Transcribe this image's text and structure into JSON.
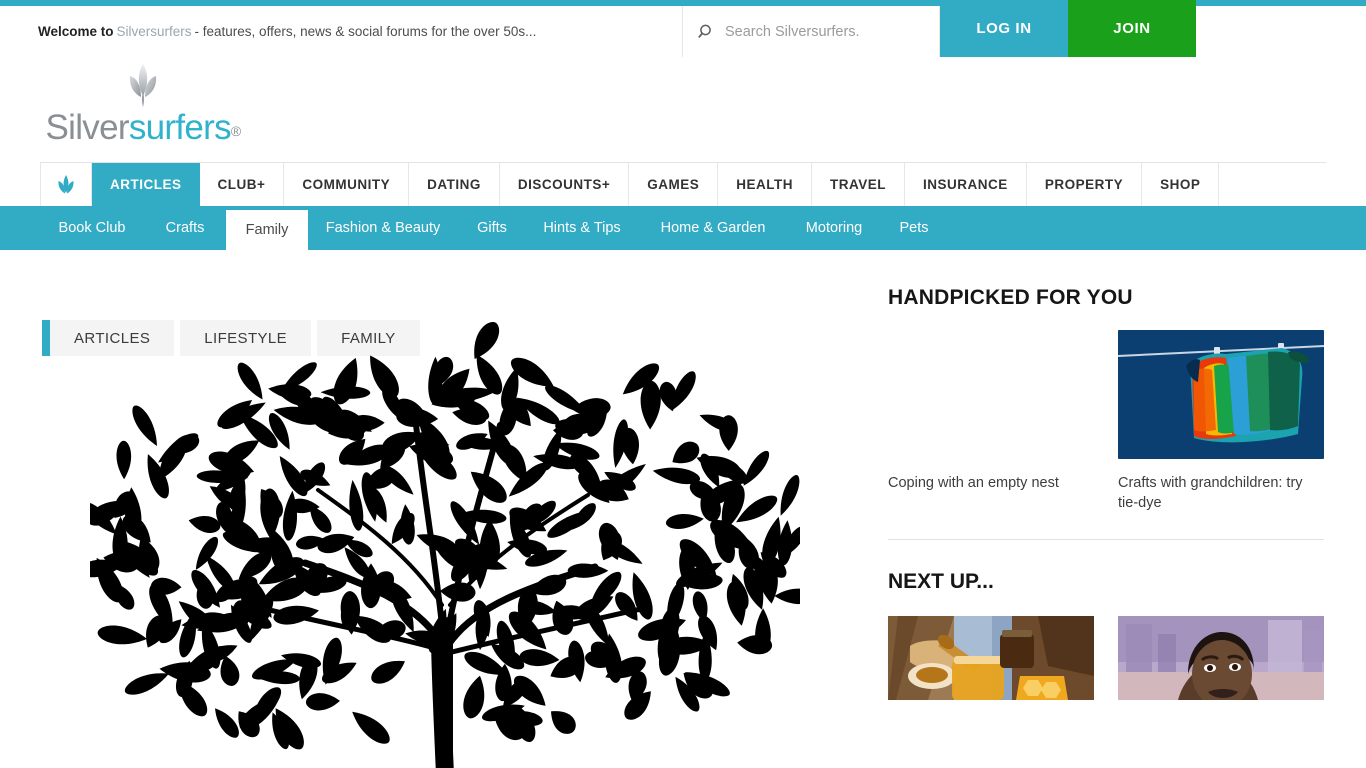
{
  "topbar": {
    "welcome_bold": "Welcome to",
    "welcome_brand": "Silversurfers",
    "welcome_rest": "- features, offers, news & social forums for the over 50s...",
    "search_placeholder": "Search Silversurfers.",
    "search_value": "",
    "search_icon": "search-icon",
    "login_label": "LOG IN",
    "join_label": "JOIN",
    "accent_color": "#32abc4",
    "join_color": "#1aa01a"
  },
  "logo": {
    "part1": "Silver",
    "part2": "surfers",
    "registered": "®",
    "mark_icon": "silversurfers-feather-icon"
  },
  "mainnav": {
    "home_icon": "home-feather-icon",
    "items": [
      {
        "label": "ARTICLES",
        "underline": "#32abc4",
        "active": true
      },
      {
        "label": "CLUB+",
        "underline": "#123a5c",
        "active": false
      },
      {
        "label": "COMMUNITY",
        "underline": "#1566b5",
        "active": false
      },
      {
        "label": "DATING",
        "underline": "#cf2030",
        "active": false
      },
      {
        "label": "DISCOUNTS+",
        "underline": "#e8853a",
        "active": false
      },
      {
        "label": "GAMES",
        "underline": "#34b7cc",
        "active": false
      },
      {
        "label": "HEALTH",
        "underline": "#ec3b16",
        "active": false
      },
      {
        "label": "TRAVEL",
        "underline": "#f5c220",
        "active": false
      },
      {
        "label": "INSURANCE",
        "underline": "#8c8c8c",
        "active": false
      },
      {
        "label": "PROPERTY",
        "underline": "#8e1212",
        "active": false
      },
      {
        "label": "SHOP",
        "underline": "#a618d6",
        "active": false
      }
    ]
  },
  "subnav": {
    "items": [
      {
        "label": "Book Club",
        "active": false
      },
      {
        "label": "Crafts",
        "active": false
      },
      {
        "label": "Family",
        "active": true
      },
      {
        "label": "Fashion & Beauty",
        "active": false
      },
      {
        "label": "Gifts",
        "active": false
      },
      {
        "label": "Hints & Tips",
        "active": false
      },
      {
        "label": "Home & Garden",
        "active": false
      },
      {
        "label": "Motoring",
        "active": false
      },
      {
        "label": "Pets",
        "active": false
      }
    ]
  },
  "collapse": {
    "icon": "chevron-left-icon"
  },
  "breadcrumb": {
    "items": [
      "ARTICLES",
      "LIFESTYLE",
      "FAMILY"
    ]
  },
  "hero": {
    "image_alt": "family-tree-silhouette"
  },
  "sidebar": {
    "handpicked_title": "HANDPICKED FOR YOU",
    "handpicked": [
      {
        "caption": "Coping with an empty nest",
        "image": "none"
      },
      {
        "caption": "Crafts with grandchildren: try tie-dye",
        "image": "tie-dye-shirt-on-clothesline"
      }
    ],
    "nextup_title": "NEXT UP...",
    "nextup": [
      {
        "caption": "",
        "image": "honey-jars-with-dipper"
      },
      {
        "caption": "",
        "image": "man-with-city-skyline"
      }
    ]
  }
}
